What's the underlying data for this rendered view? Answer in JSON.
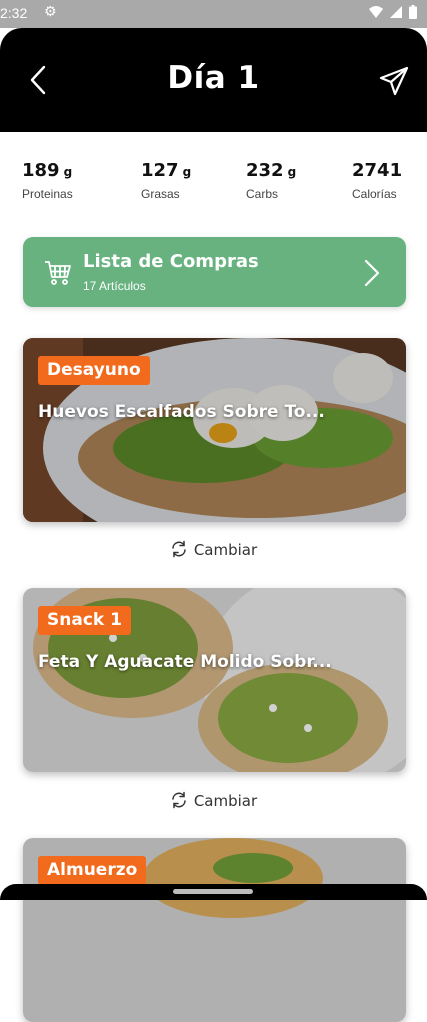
{
  "status": {
    "time": "2:32"
  },
  "header": {
    "title": "Día 1"
  },
  "macros": [
    {
      "value": "189",
      "unit": "g",
      "label": "Proteinas"
    },
    {
      "value": "127",
      "unit": "g",
      "label": "Grasas"
    },
    {
      "value": "232",
      "unit": "g",
      "label": "Carbs"
    },
    {
      "value": "2741",
      "unit": "",
      "label": "Calorías"
    }
  ],
  "shopping": {
    "title": "Lista de Compras",
    "subtitle": "17 Artículos"
  },
  "meals": [
    {
      "tag": "Desayuno",
      "name": "Huevos Escalfados Sobre To...",
      "swap": "Cambiar"
    },
    {
      "tag": "Snack 1",
      "name": "Feta Y Aguacate Molido Sobr...",
      "swap": "Cambiar"
    },
    {
      "tag": "Almuerzo"
    }
  ],
  "colors": {
    "accent": "#f26a1b",
    "shopping_bg": "#67b27f",
    "header_bg": "#000000"
  }
}
